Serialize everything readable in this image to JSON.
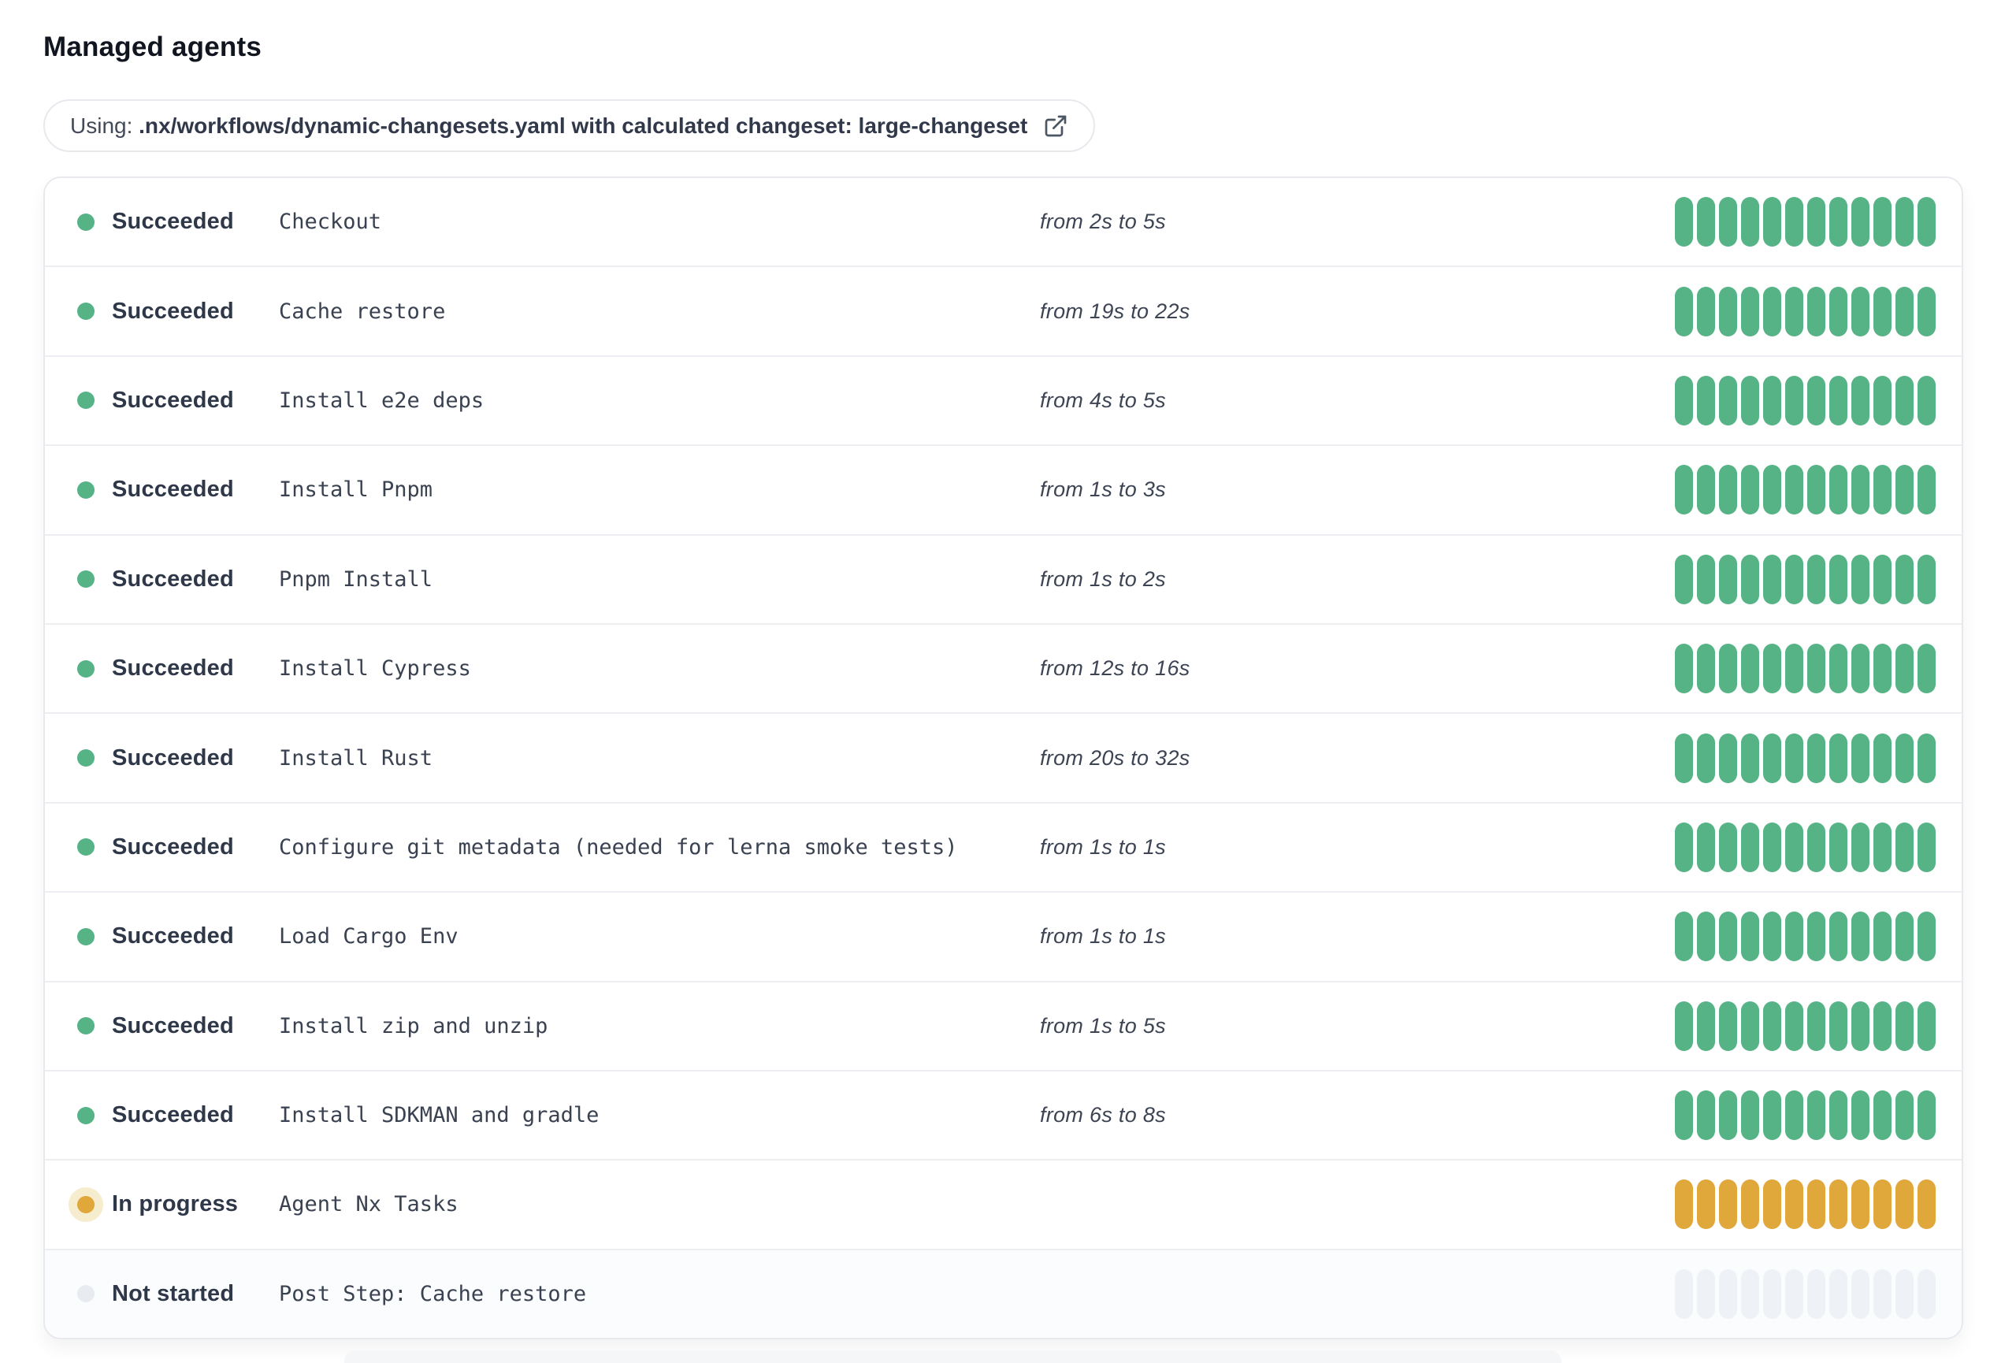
{
  "page": {
    "title": "Managed agents"
  },
  "workflow_chip": {
    "prefix": "Using: ",
    "path_text": ".nx/workflows/dynamic-changesets.yaml with calculated changeset: large-changeset",
    "icon": "external-link-icon"
  },
  "colors": {
    "succeeded": "#55b385",
    "in_progress": "#e0a73a",
    "not_started": "#eef2f6"
  },
  "agents": {
    "segments_per_bar": 12,
    "rows": [
      {
        "status": "succeeded",
        "status_label": "Succeeded",
        "step": "Checkout",
        "duration": "from 2s to 5s"
      },
      {
        "status": "succeeded",
        "status_label": "Succeeded",
        "step": "Cache restore",
        "duration": "from 19s to 22s"
      },
      {
        "status": "succeeded",
        "status_label": "Succeeded",
        "step": "Install e2e deps",
        "duration": "from 4s to 5s"
      },
      {
        "status": "succeeded",
        "status_label": "Succeeded",
        "step": "Install Pnpm",
        "duration": "from 1s to 3s"
      },
      {
        "status": "succeeded",
        "status_label": "Succeeded",
        "step": "Pnpm Install",
        "duration": "from 1s to 2s"
      },
      {
        "status": "succeeded",
        "status_label": "Succeeded",
        "step": "Install Cypress",
        "duration": "from 12s to 16s"
      },
      {
        "status": "succeeded",
        "status_label": "Succeeded",
        "step": "Install Rust",
        "duration": "from 20s to 32s"
      },
      {
        "status": "succeeded",
        "status_label": "Succeeded",
        "step": "Configure git metadata (needed for lerna smoke tests)",
        "duration": "from 1s to 1s"
      },
      {
        "status": "succeeded",
        "status_label": "Succeeded",
        "step": "Load Cargo Env",
        "duration": "from 1s to 1s"
      },
      {
        "status": "succeeded",
        "status_label": "Succeeded",
        "step": "Install zip and unzip",
        "duration": "from 1s to 5s"
      },
      {
        "status": "succeeded",
        "status_label": "Succeeded",
        "step": "Install SDKMAN and gradle",
        "duration": "from 6s to 8s"
      },
      {
        "status": "in_progress",
        "status_label": "In progress",
        "step": "Agent Nx Tasks",
        "duration": ""
      },
      {
        "status": "not_started",
        "status_label": "Not started",
        "step": "Post Step: Cache restore",
        "duration": ""
      }
    ]
  }
}
